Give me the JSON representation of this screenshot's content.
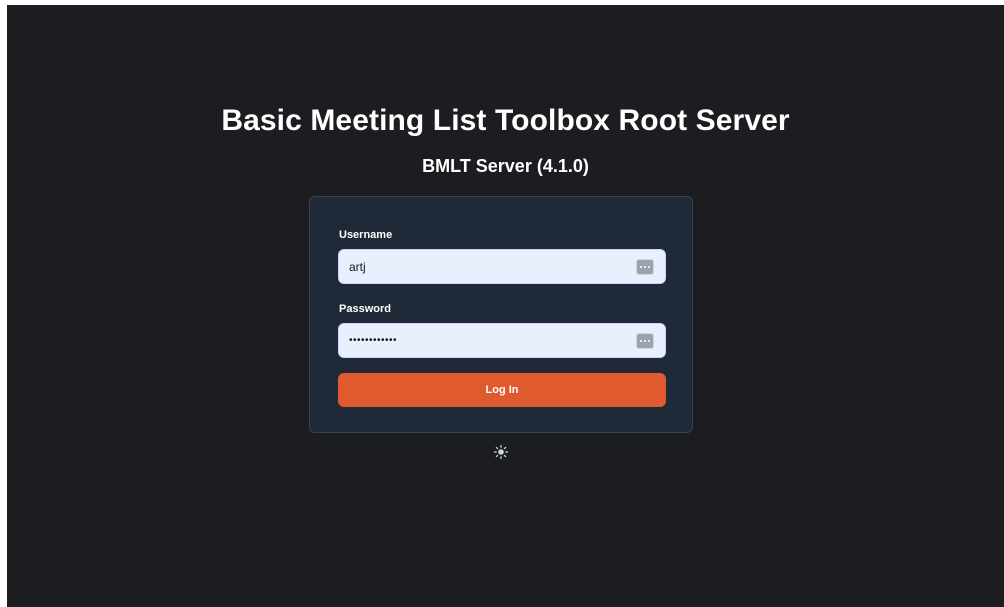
{
  "header": {
    "title": "Basic Meeting List Toolbox Root Server",
    "subtitle": "BMLT Server (4.1.0)"
  },
  "login_form": {
    "username": {
      "label": "Username",
      "value": "artj",
      "placeholder": ""
    },
    "password": {
      "label": "Password",
      "value": "••••••••••••",
      "placeholder": ""
    },
    "submit_label": "Log In"
  },
  "icons": {
    "theme_toggle": "sun-icon",
    "autofill": "password-manager-icon"
  },
  "colors": {
    "background": "#1b1d20",
    "card": "#1f2937",
    "input": "#e8f0fe",
    "accent": "#e05a2f"
  }
}
